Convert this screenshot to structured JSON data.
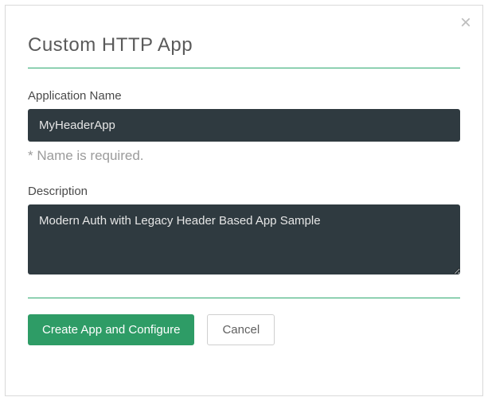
{
  "modal": {
    "title": "Custom HTTP App",
    "close_glyph": "×"
  },
  "fields": {
    "app_name": {
      "label": "Application Name",
      "value": "MyHeaderApp",
      "hint": "* Name is required."
    },
    "description": {
      "label": "Description",
      "value": "Modern Auth with Legacy Header Based App Sample"
    }
  },
  "footer": {
    "create_label": "Create App and Configure",
    "cancel_label": "Cancel"
  },
  "colors": {
    "accent": "#2e9c66",
    "input_bg": "#2f3a40"
  }
}
